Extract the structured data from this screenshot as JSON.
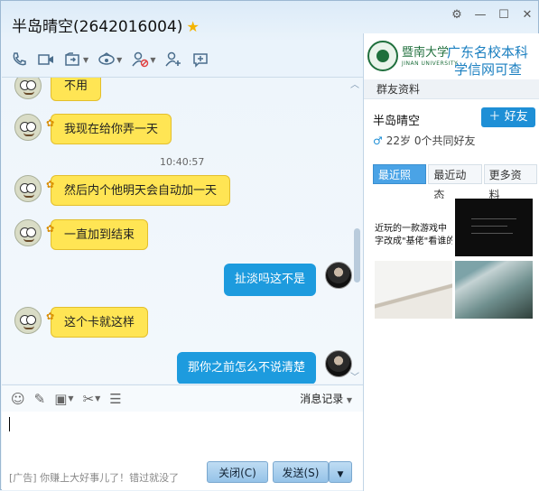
{
  "window": {
    "title": "半岛晴空(2642016004)",
    "controls": [
      "settings",
      "minimize",
      "maximize",
      "close"
    ]
  },
  "toolbar": {
    "icons": [
      "phone-icon",
      "video-icon",
      "share-screen-icon",
      "remote-assist-icon",
      "block-icon",
      "add-user-icon",
      "comment-icon"
    ]
  },
  "chat": {
    "messages": [
      {
        "side": "left",
        "text": "不用"
      },
      {
        "side": "left",
        "text": "我现在给你弄一天"
      },
      {
        "side": "time",
        "text": "10:40:57"
      },
      {
        "side": "left",
        "text": "然后内个他明天会自动加一天"
      },
      {
        "side": "left",
        "text": "一直加到结束"
      },
      {
        "side": "right",
        "text": "扯淡吗这不是"
      },
      {
        "side": "left",
        "text": "这个卡就这样"
      },
      {
        "side": "right",
        "text": "那你之前怎么不说清楚"
      }
    ]
  },
  "input_toolbar": {
    "icons": [
      "emoji-icon",
      "font-icon",
      "image-icon",
      "screenshot-icon",
      "shake-icon"
    ],
    "history_label": "消息记录"
  },
  "input": {
    "value": ""
  },
  "footer": {
    "ad_text": "[广告] 你赚上大好事儿了！错过就没了",
    "close_label": "关闭(C)",
    "send_label": "发送(S)"
  },
  "sidebar": {
    "banner": {
      "university": "暨南大学",
      "university_en": "JINAN UNIVERSITY",
      "ad_line1": "广东名校本科",
      "ad_line2": "学信网可查"
    },
    "section_title": "群友资料",
    "profile": {
      "name": "半岛晴空",
      "add_friend_label": "好友",
      "info": "22岁 0个共同好友"
    },
    "tabs": [
      "最近照片",
      "最近动态",
      "更多资料"
    ],
    "active_tab": 0,
    "photo1_lines": [
      "近玩的一款游戏中",
      "字改成\"基佬\"看谁的"
    ]
  },
  "colors": {
    "bubble_left": "#ffe554",
    "bubble_right": "#1d9bde",
    "accent": "#1e8fd6"
  }
}
